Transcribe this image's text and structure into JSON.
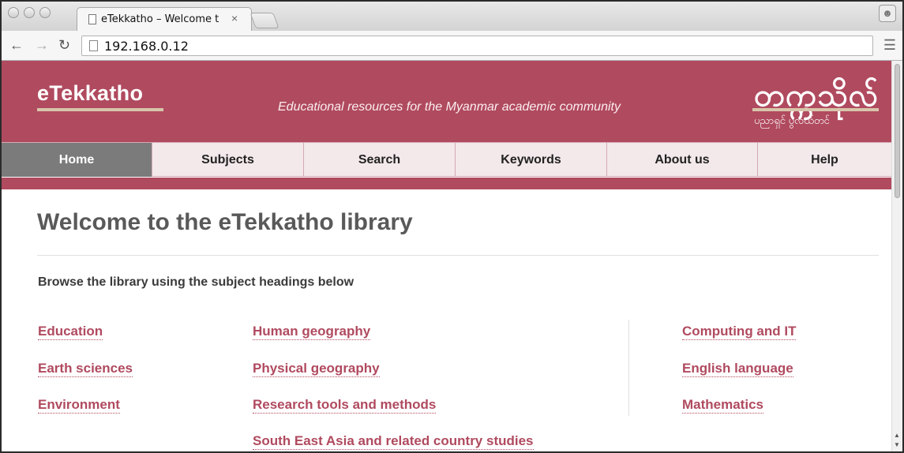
{
  "browser": {
    "tab_title": "eTekkatho – Welcome to th",
    "url": "192.168.0.12"
  },
  "header": {
    "logo": "eTekkatho",
    "tagline": "Educational resources for the Myanmar academic community",
    "myanmar_title": "တက္ကသိုလ်",
    "myanmar_subtitle": "ပညာရှင် ပွဲလယ်တင်",
    "brand_color": "#b04a5f"
  },
  "nav": {
    "items": [
      {
        "label": "Home",
        "active": true
      },
      {
        "label": "Subjects",
        "active": false
      },
      {
        "label": "Search",
        "active": false
      },
      {
        "label": "Keywords",
        "active": false
      },
      {
        "label": "About us",
        "active": false
      },
      {
        "label": "Help",
        "active": false
      }
    ]
  },
  "main": {
    "title": "Welcome to the eTekkatho library",
    "browse_text": "Browse the library using the subject headings below",
    "subjects": {
      "col1": [
        "Education",
        "Earth sciences",
        "Environment"
      ],
      "col2": [
        "Human geography",
        "Physical geography",
        "Research tools and methods",
        "South East Asia and related country studies"
      ],
      "col3": [
        "Computing and IT",
        "English language",
        "Mathematics"
      ]
    }
  }
}
